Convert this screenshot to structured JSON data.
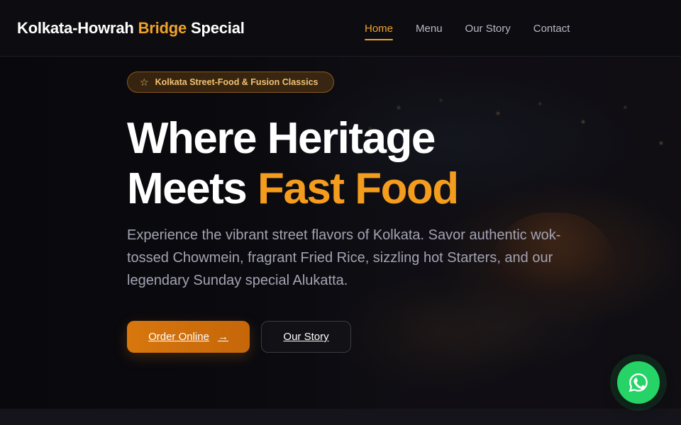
{
  "header": {
    "logo_part1": "Kolkata-Howrah",
    "logo_accent": "Bridge",
    "logo_part2": "Special",
    "nav": [
      {
        "label": "Home",
        "active": true
      },
      {
        "label": "Menu",
        "active": false
      },
      {
        "label": "Our Story",
        "active": false
      },
      {
        "label": "Contact",
        "active": false
      }
    ]
  },
  "hero": {
    "badge_icon": "star-icon",
    "badge": "Kolkata Street-Food & Fusion Classics",
    "title_line1": "Where Heritage",
    "title_line2_plain": "Meets",
    "title_line2_accent": "Fast Food",
    "lead": "Experience the vibrant street flavors of Kolkata. Savor authentic wok-tossed Chowmein, fragrant Fried Rice, sizzling hot Starters, and our legendary Sunday special Alukatta.",
    "primary_button": "Order Online",
    "primary_button_icon": "arrow-right-icon",
    "secondary_button": "Our Story"
  },
  "floating": {
    "icon": "whatsapp-icon"
  },
  "colors": {
    "accent": "#f0a22a",
    "primary_button": "#d8770d",
    "whatsapp": "#25d366",
    "background": "#0b0a0d"
  }
}
